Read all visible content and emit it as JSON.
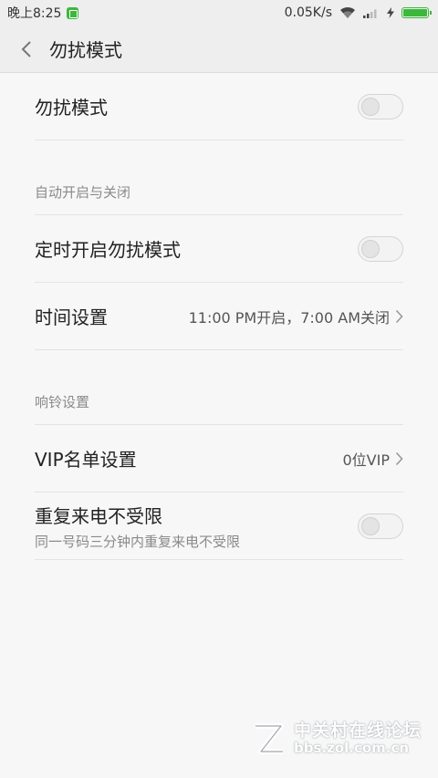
{
  "status_bar": {
    "time": "晚上8:25",
    "network_speed": "0.05K/s",
    "icons": [
      "app-notification-icon",
      "wifi-icon",
      "signal-icon",
      "charging-icon",
      "battery-icon"
    ],
    "battery_level": 1.0
  },
  "header": {
    "title": "勿扰模式",
    "back_icon": "chevron-left-icon"
  },
  "main": {
    "dnd_toggle": {
      "label": "勿扰模式",
      "on": false
    },
    "auto_section": {
      "header": "自动开启与关闭",
      "scheduled_toggle": {
        "label": "定时开启勿扰模式",
        "on": false
      },
      "time_setting": {
        "label": "时间设置",
        "value": "11:00 PM开启，7:00 AM关闭"
      }
    },
    "ring_section": {
      "header": "响铃设置",
      "vip_setting": {
        "label": "VIP名单设置",
        "value": "0位VIP"
      },
      "repeat_calls": {
        "label": "重复来电不受限",
        "description": "同一号码三分钟内重复来电不受限",
        "on": false
      }
    }
  },
  "watermark": {
    "name": "中关村在线论坛",
    "url": "bbs.zol.com.cn"
  },
  "colors": {
    "background": "#f7f7f7",
    "bar_background": "#eeeeee",
    "battery": "#3cb83c",
    "divider": "#e3e3e3",
    "secondary_text": "#8a8a8a"
  }
}
